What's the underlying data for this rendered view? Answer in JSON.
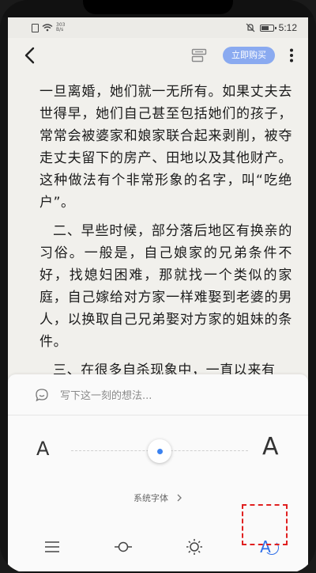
{
  "status_bar": {
    "network_speed": "303\nB/s",
    "time": "5:12"
  },
  "toolbar": {
    "buy_label": "立即购买"
  },
  "content": {
    "paragraphs": [
      "一旦离婚，她们就一无所有。如果丈夫去世得早，她们自己甚至包括她们的孩子，常常会被婆家和娘家联合起来剥削，被夺走丈夫留下的房产、田地以及其他财产。这种做法有个非常形象的名字，叫“吃绝户”。",
      "二、早些时候，部分落后地区有换亲的习俗。一般是，自己娘家的兄弟条件不好，找媳妇困难，那就找一个类似的家庭，自己嫁给对方家一样难娶到老婆的男人，以换取自己兄弟娶对方家的姐妹的条件。",
      "三、在很多自杀现象中，一直以来有"
    ]
  },
  "panel": {
    "thought_placeholder": "写下这一刻的想法...",
    "font_small_label": "A",
    "font_large_label": "A",
    "font_size_level": 0.5,
    "typeface_label": "系统字体",
    "tabs": [
      {
        "name": "menu-icon"
      },
      {
        "name": "progress-icon"
      },
      {
        "name": "brightness-icon"
      },
      {
        "name": "font-settings-icon",
        "label": "A",
        "active": true
      }
    ]
  },
  "colors": {
    "accent": "#3b82f0",
    "buy_button": "#8aaaf0",
    "page_bg": "#f1f0ec",
    "highlight": "#e02020"
  }
}
